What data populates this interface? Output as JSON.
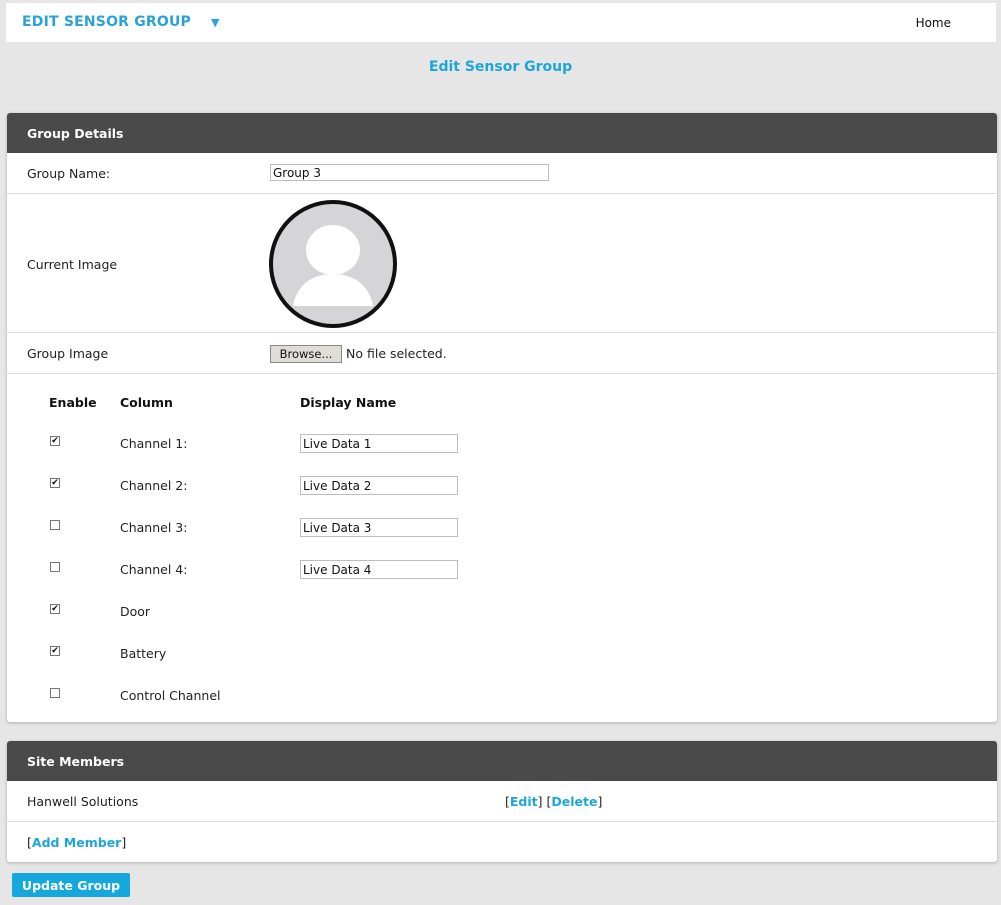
{
  "header": {
    "app_title": "EDIT SENSOR GROUP",
    "dropdown_arrow": "▼",
    "home_label": "Home"
  },
  "page_title": "Edit Sensor Group",
  "group_details": {
    "header": "Group Details",
    "group_name_label": "Group Name:",
    "group_name_value": "Group 3",
    "current_image_label": "Current Image",
    "group_image_label": "Group Image",
    "browse_label": "Browse...",
    "file_status": "No file selected.",
    "columns": {
      "enable": "Enable",
      "column": "Column",
      "display_name": "Display Name"
    },
    "channels": [
      {
        "label": "Channel 1:",
        "enabled": true,
        "display_name": "Live Data 1"
      },
      {
        "label": "Channel 2:",
        "enabled": true,
        "display_name": "Live Data 2"
      },
      {
        "label": "Channel 3:",
        "enabled": false,
        "display_name": "Live Data 3"
      },
      {
        "label": "Channel 4:",
        "enabled": false,
        "display_name": "Live Data 4"
      },
      {
        "label": "Door",
        "enabled": true
      },
      {
        "label": "Battery",
        "enabled": true
      },
      {
        "label": "Control Channel",
        "enabled": false
      }
    ]
  },
  "site_members": {
    "header": "Site Members",
    "members": [
      {
        "name": "Hanwell Solutions",
        "edit_label": "Edit",
        "delete_label": "Delete"
      }
    ],
    "add_member_label": "Add Member"
  },
  "update_button_label": "Update Group",
  "colors": {
    "accent": "#1ea6d6",
    "panel_header": "#4a4a4a",
    "background": "#e6e6e6"
  }
}
